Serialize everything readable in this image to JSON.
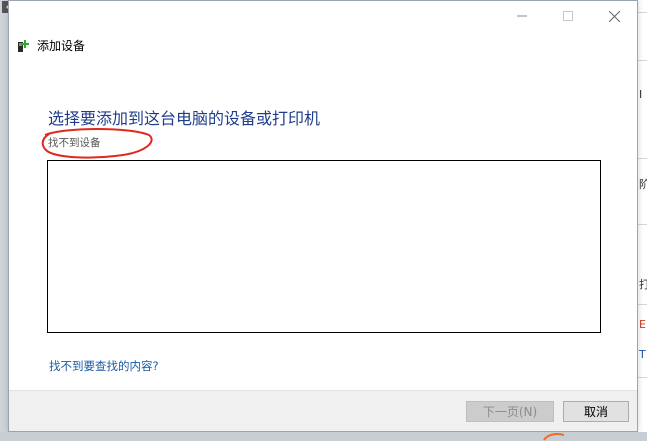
{
  "window": {
    "title": "添加设备",
    "controls": [
      "minimize",
      "maximize",
      "close"
    ]
  },
  "main": {
    "heading": "选择要添加到这台电脑的设备或打印机",
    "status": "找不到设备",
    "help_link": "找不到要查找的内容?"
  },
  "footer": {
    "next_label": "下一页(N)",
    "cancel_label": "取消"
  },
  "background_window": {
    "texts": [
      "I",
      "阶",
      "打",
      "E",
      "T"
    ]
  },
  "colors": {
    "heading": "#1f3d8a",
    "link": "#1a5aa6",
    "annotation": "#e0281c",
    "footer_bg": "#f0f0f0"
  },
  "icons": {
    "window_icon": "device-add-icon",
    "minimize": "minimize-icon",
    "maximize": "maximize-icon",
    "close": "close-icon"
  }
}
